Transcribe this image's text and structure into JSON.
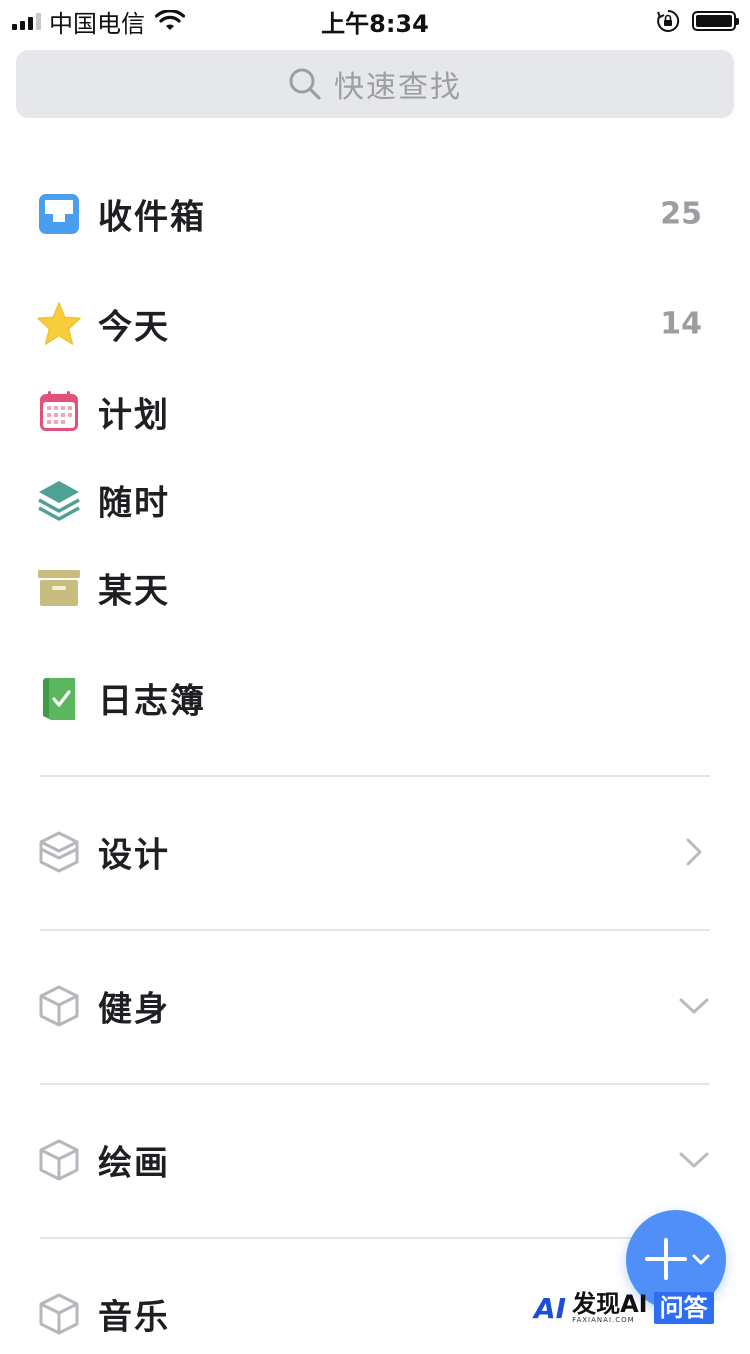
{
  "status_bar": {
    "carrier": "中国电信",
    "time": "上午8:34"
  },
  "search": {
    "placeholder": "快速查找"
  },
  "smart_lists": [
    {
      "label": "收件箱",
      "count": "25",
      "icon": "inbox-icon"
    },
    {
      "label": "今天",
      "count": "14",
      "icon": "star-icon"
    },
    {
      "label": "计划",
      "count": "",
      "icon": "calendar-icon"
    },
    {
      "label": "随时",
      "count": "",
      "icon": "layers-icon"
    },
    {
      "label": "某天",
      "count": "",
      "icon": "archive-box-icon"
    },
    {
      "label": "日志簿",
      "count": "",
      "icon": "logbook-icon"
    }
  ],
  "areas": [
    {
      "label": "设计",
      "state": "collapsed",
      "icon": "cube-icon"
    },
    {
      "label": "健身",
      "state": "expandable",
      "icon": "cube-icon"
    },
    {
      "label": "绘画",
      "state": "expandable",
      "icon": "cube-icon"
    },
    {
      "label": "音乐",
      "state": "",
      "icon": "cube-icon"
    }
  ],
  "watermark": {
    "logo": "AI",
    "name": "发现AI",
    "domain": "FAXIANAI.COM",
    "badge": "问答"
  },
  "colors": {
    "accent": "#4f8ff7",
    "inbox": "#4a9ef0",
    "star": "#f7cd3b",
    "calendar": "#e3507a",
    "anytime": "#4fa194",
    "someday": "#c9bc7f",
    "logbook": "#5bb660"
  }
}
